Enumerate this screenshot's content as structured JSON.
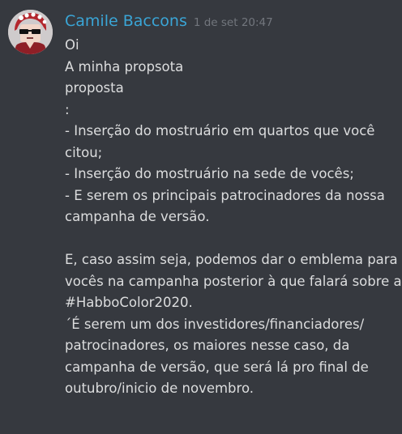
{
  "message": {
    "author": "Camile Baccons",
    "timestamp": "1 de set 20:47",
    "lines": [
      "Oi",
      "A minha propsota",
      "proposta",
      ":",
      "- Inserção do mostruário em quartos que você",
      "citou;",
      "- Inserção do mostruário na sede de vocês;",
      "- E serem os principais patrocinadores da nossa",
      "campanha de versão.",
      "",
      "E, caso assim seja, podemos dar o emblema para",
      "vocês na campanha posterior à que falará sobre a",
      "#HabboColor2020.",
      "´É serem um dos investidores/financiadores/",
      "patrocinadores, os maiores nesse caso, da",
      "campanha de versão, que será lá pro final de",
      "outubro/inicio de novembro."
    ]
  },
  "colors": {
    "background": "#36393f",
    "username": "#3aa5d6",
    "timestamp": "#72767d",
    "text": "#dcddde"
  },
  "icons": {
    "avatar": "user-avatar-icon"
  }
}
